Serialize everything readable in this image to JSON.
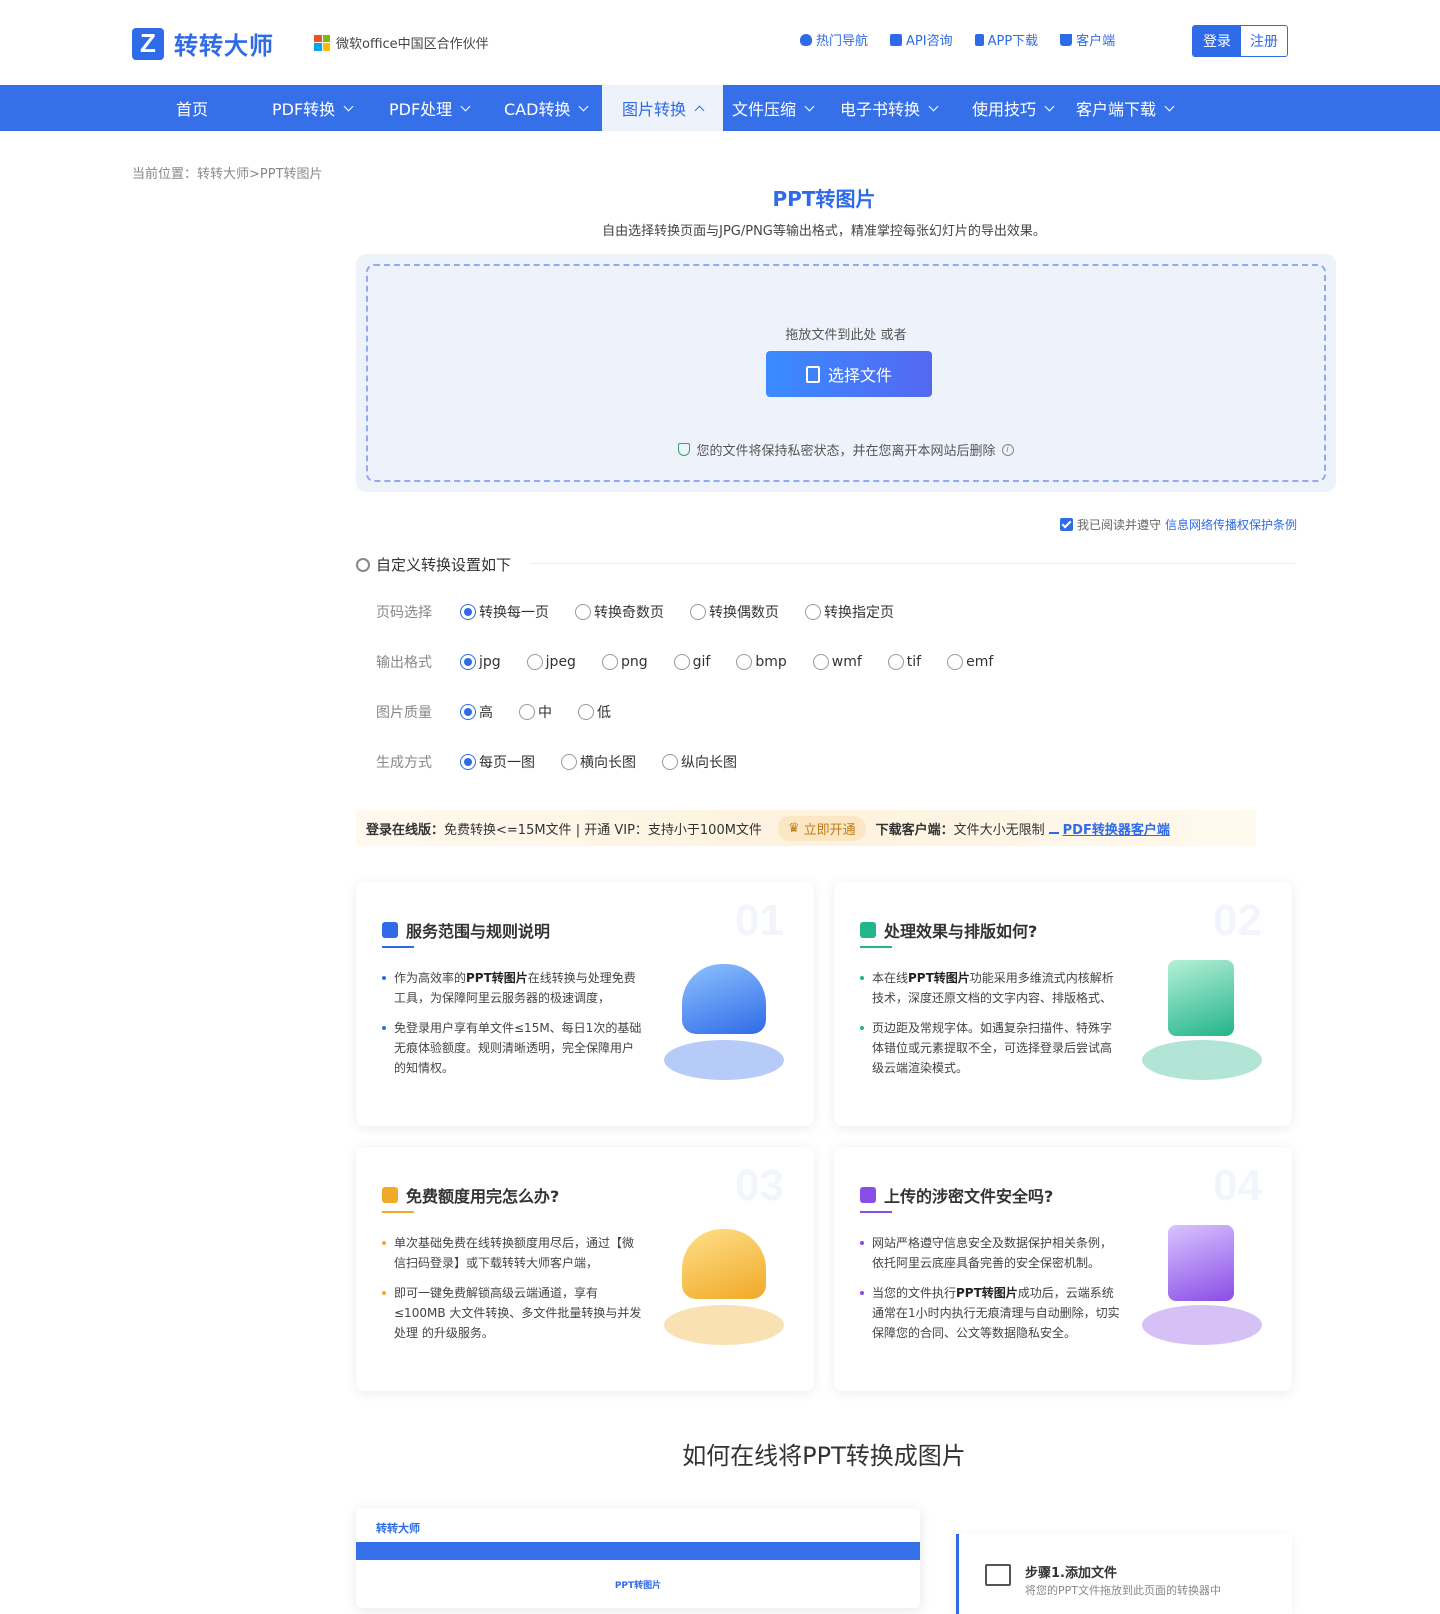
{
  "brand": {
    "logo_letter": "Z",
    "name": "转转大师",
    "partner": "微软office中国区合作伙伴"
  },
  "topnav": [
    {
      "label": "热门导航",
      "icon": "fire-icon"
    },
    {
      "label": "API咨询",
      "icon": "chat-icon"
    },
    {
      "label": "APP下载",
      "icon": "phone-icon"
    },
    {
      "label": "客户端",
      "icon": "download-icon"
    }
  ],
  "auth": {
    "login": "登录",
    "register": "注册"
  },
  "mainnav": [
    {
      "label": "首页"
    },
    {
      "label": "PDF转换"
    },
    {
      "label": "PDF处理"
    },
    {
      "label": "CAD转换"
    },
    {
      "label": "图片转换",
      "active": true
    },
    {
      "label": "文件压缩"
    },
    {
      "label": "电子书转换"
    },
    {
      "label": "使用技巧"
    },
    {
      "label": "客户端下载"
    }
  ],
  "breadcrumb": "当前位置：转转大师>PPT转图片",
  "page": {
    "title": "PPT转图片",
    "subtitle": "自由选择转换页面与JPG/PNG等输出格式，精准掌控每张幻灯片的导出效果。"
  },
  "upload": {
    "hint": "拖放文件到此处 或者",
    "button": "选择文件",
    "privacy": "您的文件将保持私密状态，并在您离开本网站后删除"
  },
  "agree": {
    "text": "我已阅读并遵守",
    "link": "信息网络传播权保护条例",
    "checked": true
  },
  "settings": {
    "title": "自定义转换设置如下",
    "rows": [
      {
        "label": "页码选择",
        "options": [
          "转换每一页",
          "转换奇数页",
          "转换偶数页",
          "转换指定页"
        ],
        "selected": 0
      },
      {
        "label": "输出格式",
        "options": [
          "jpg",
          "jpeg",
          "png",
          "gif",
          "bmp",
          "wmf",
          "tif",
          "emf"
        ],
        "selected": 0
      },
      {
        "label": "图片质量",
        "options": [
          "高",
          "中",
          "低"
        ],
        "selected": 0
      },
      {
        "label": "生成方式",
        "options": [
          "每页一图",
          "横向长图",
          "纵向长图"
        ],
        "selected": 0
      }
    ]
  },
  "promo": {
    "online_label": "登录在线版：",
    "online_text": "免费转换<=15M文件 | 开通 VIP：支持小于100M文件",
    "vip_button": "立即开通",
    "client_label": "下载客户端：",
    "client_text": "文件大小无限制",
    "client_link": "PDF转换器客户端"
  },
  "cards": [
    {
      "num": "01",
      "title": "服务范围与规则说明",
      "accent": "#2f6be8",
      "items": [
        {
          "pre": "作为高效率的",
          "bold": "PPT转图片",
          "post": "在线转换与处理免费工具，为保障阿里云服务器的极速调度，"
        },
        {
          "pre": "免登录用户享有单文件≤15M、每日1次的基础无痕体验额度。规则清晰透明，完全保障用户的知情权。",
          "bold": "",
          "post": ""
        }
      ]
    },
    {
      "num": "02",
      "title": "处理效果与排版如何?",
      "accent": "#22b48a",
      "items": [
        {
          "pre": "本在线",
          "bold": "PPT转图片",
          "post": "功能采用多维流式内核解析技术，深度还原文档的文字内容、排版格式、"
        },
        {
          "pre": "页边距及常规字体。如遇复杂扫描件、特殊字体错位或元素提取不全，可选择登录后尝试高级云端渲染模式。",
          "bold": "",
          "post": ""
        }
      ]
    },
    {
      "num": "03",
      "title": "免费额度用完怎么办?",
      "accent": "#f0a928",
      "items": [
        {
          "pre": "单次基础免费在线转换额度用尽后，通过【微信扫码登录】或下载转转大师客户端，",
          "bold": "",
          "post": ""
        },
        {
          "pre": "即可一键免费解锁高级云端通道，享有≤100MB 大文件转换、多文件批量转换与并发处理 的升级服务。",
          "bold": "",
          "post": ""
        }
      ]
    },
    {
      "num": "04",
      "title": "上传的涉密文件安全吗?",
      "accent": "#8a4de6",
      "items": [
        {
          "pre": "网站严格遵守信息安全及数据保护相关条例，依托阿里云底座具备完善的安全保密机制。",
          "bold": "",
          "post": ""
        },
        {
          "pre": "当您的文件执行",
          "bold": "PPT转图片",
          "post": "成功后，云端系统通常在1小时内执行无痕清理与自动删除，切实保障您的合同、公文等数据隐私安全。"
        }
      ]
    }
  ],
  "how": {
    "title": "如何在线将PPT转换成图片",
    "shot_logo": "转转大师",
    "shot_title": "PPT转图片",
    "step_title": "步骤1.添加文件",
    "step_desc": "将您的PPT文件拖放到此页面的转换器中"
  }
}
